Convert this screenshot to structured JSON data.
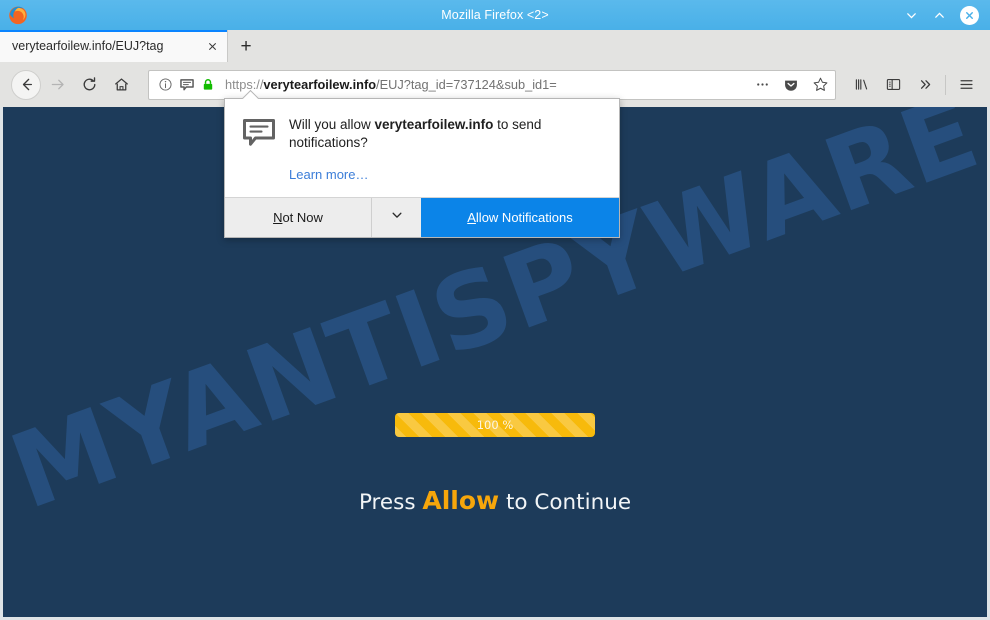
{
  "window": {
    "title": "Mozilla Firefox <2>",
    "logo_icon": "firefox-logo-icon",
    "controls": {
      "minimize_icon": "chevron-down-icon",
      "maximize_icon": "chevron-up-icon",
      "close_icon": "close-x-icon"
    },
    "titlebar_color": "#49b0e8"
  },
  "tabs": {
    "items": [
      {
        "label": "verytearfoilew.info/EUJ?tag",
        "close_icon": "close-tab-icon",
        "active": true
      }
    ],
    "new_tab_label": "+"
  },
  "toolbar": {
    "back_icon": "back-arrow-icon",
    "forward_icon": "forward-arrow-icon",
    "reload_icon": "reload-icon",
    "home_icon": "home-icon",
    "library_icon": "library-icon",
    "sidebar_icon": "sidebar-icon",
    "overflow_icon": "chevron-double-right-icon",
    "menu_icon": "hamburger-menu-icon"
  },
  "urlbar": {
    "info_icon": "page-info-icon",
    "notification_icon": "notification-bubble-icon",
    "lock_icon": "padlock-secure-icon",
    "lock_color": "#12bc00",
    "scheme": "https://",
    "domain": "verytearfoilew.info",
    "path": "/EUJ?tag_id=737124&sub_id1=",
    "full_url": "https://verytearfoilew.info/EUJ?tag_id=737124&sub_id1=",
    "page_actions_icon": "page-actions-ellipsis-icon",
    "pocket_icon": "pocket-icon",
    "bookmark_icon": "bookmark-star-icon"
  },
  "popup": {
    "icon": "notification-bubble-icon",
    "question_prefix": "Will you allow ",
    "question_domain": "verytearfoilew.info",
    "question_suffix": " to send notifications?",
    "learn_more": "Learn more…",
    "not_now_label": "Not Now",
    "not_now_accesskey": "N",
    "dropdown_icon": "chevron-down-icon",
    "allow_label": "Allow Notifications",
    "allow_accesskey": "A",
    "allow_color": "#0b84e8"
  },
  "page": {
    "background_color": "#1d3b5a",
    "watermark": "MYANTISPYWARE.COM",
    "watermark_color": "#27507f",
    "progress": {
      "percent_label": "100 %",
      "percent_value": 100,
      "bar_color": "#f7ba0b"
    },
    "cta": {
      "before": "Press ",
      "highlight": "Allow",
      "after": " to Continue",
      "highlight_color": "#f6a60b"
    }
  }
}
